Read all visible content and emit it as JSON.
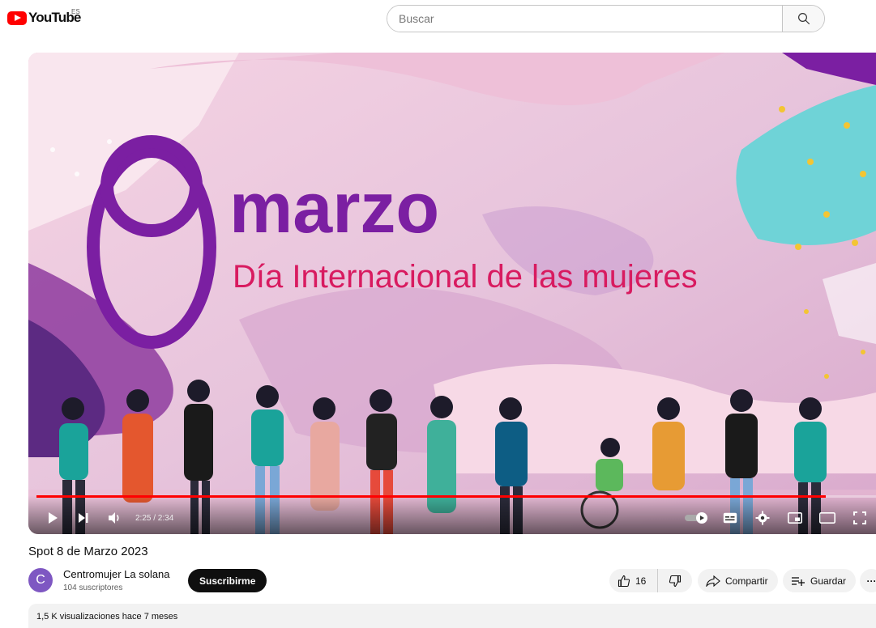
{
  "header": {
    "logo_text": "YouTube",
    "country_code": "ES",
    "search_placeholder": "Buscar"
  },
  "player": {
    "video_text": {
      "number": "8",
      "month": "marzo",
      "subtitle": "Día Internacional de las mujeres"
    },
    "time_display": "2:25 / 2:34",
    "progress_fraction": 0.94
  },
  "video": {
    "title": "Spot 8 de Marzo 2023",
    "channel_initial": "C",
    "channel_name": "Centromujer La solana",
    "subscribers": "104 suscriptores",
    "subscribe_label": "Suscribirme",
    "likes": "16",
    "share_label": "Compartir",
    "save_label": "Guardar",
    "more_label": "···",
    "stats": "1,5 K visualizaciones  hace 7 meses"
  },
  "colors": {
    "accent": "#ff0000",
    "purple": "#7b1fa2",
    "pink": "#d81b60",
    "avatar": "#7e57c2"
  },
  "icons": [
    "search-icon",
    "play-icon",
    "next-icon",
    "volume-icon",
    "autoplay-icon",
    "subtitles-icon",
    "settings-icon",
    "miniplayer-icon",
    "theater-icon",
    "fullscreen-icon",
    "like-icon",
    "dislike-icon",
    "share-icon",
    "save-icon"
  ]
}
